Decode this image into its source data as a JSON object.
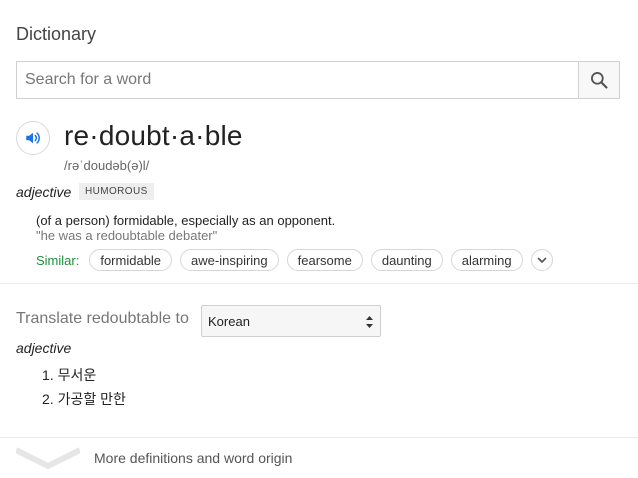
{
  "title": "Dictionary",
  "search": {
    "placeholder": "Search for a word",
    "value": ""
  },
  "entry": {
    "headword": "re·doubt·a·ble",
    "phonetic": "/rəˈdoudəb(ə)l/",
    "part_of_speech": "adjective",
    "label": "HUMOROUS",
    "definition": "(of a person) formidable, especially as an opponent.",
    "example": "\"he was a redoubtable debater\"",
    "similar_label": "Similar:",
    "similar": [
      "formidable",
      "awe-inspiring",
      "fearsome",
      "daunting",
      "alarming"
    ]
  },
  "translate": {
    "label": "Translate redoubtable to",
    "language": "Korean",
    "part_of_speech": "adjective",
    "items": [
      "1. 무서운",
      "2. 가공할 만한"
    ]
  },
  "footer": {
    "more_label": "More definitions and word origin"
  },
  "colors": {
    "similar_label": "#1e8e3e",
    "speaker_icon": "#1a73e8"
  },
  "icons": [
    "search-icon",
    "speaker-icon",
    "chevron-down-icon",
    "sort-arrows-icon",
    "expand-chevron-icon"
  ]
}
